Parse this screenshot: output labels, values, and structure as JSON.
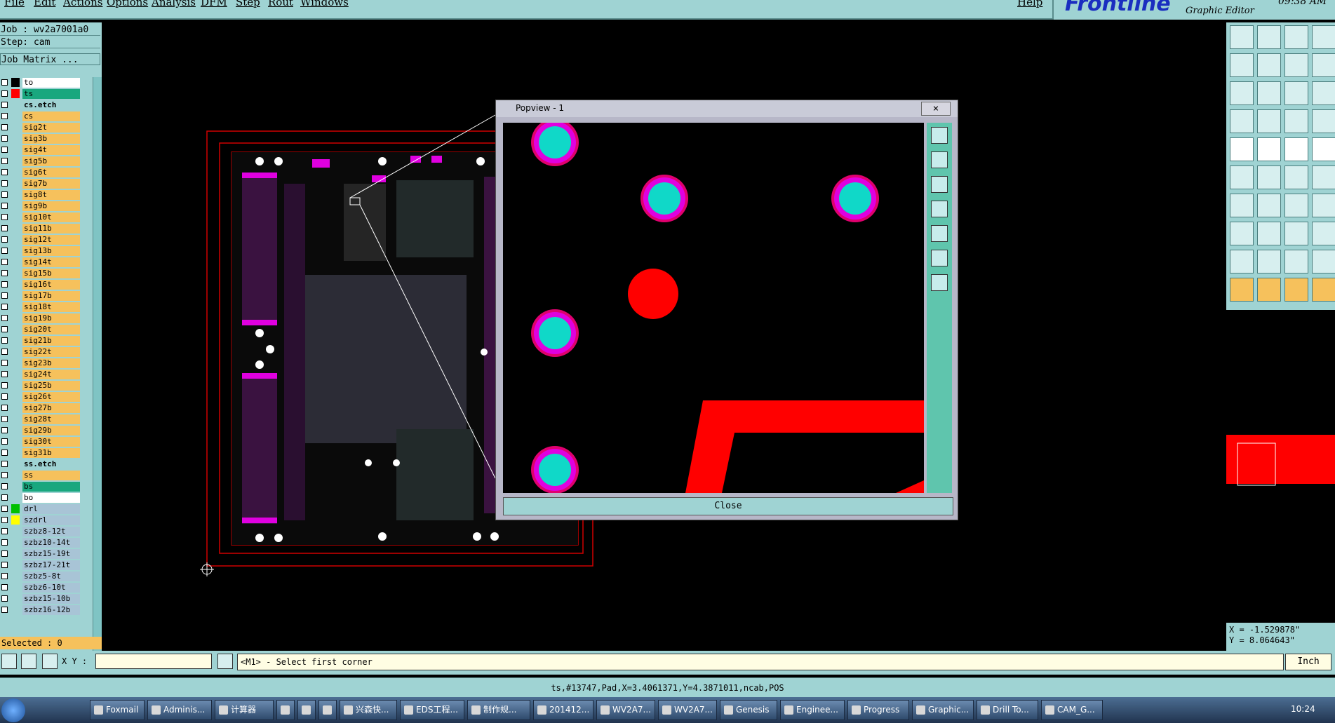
{
  "menu": {
    "items": [
      "File",
      "Edit",
      "Actions",
      "Options",
      "Analysis",
      "DFM",
      "Step",
      "Rout",
      "Windows"
    ],
    "help": "Help"
  },
  "brand": {
    "logo": "Frontline",
    "subtitle": "Graphic Editor",
    "clock": "09:38 AM"
  },
  "job": {
    "job": "Job : wv2a7001a0",
    "step": "Step: cam",
    "matrix": "Job Matrix ..."
  },
  "layers": [
    {
      "name": "to",
      "color": "#ffffff",
      "swatch": "#000000"
    },
    {
      "name": "ts",
      "color": "#19a77e",
      "swatch": "#ff0000"
    },
    {
      "name": "cs.etch",
      "color": "#9fd3d3",
      "swatch": null,
      "sep": true
    },
    {
      "name": "cs",
      "color": "#f6c15c"
    },
    {
      "name": "sig2t",
      "color": "#f6c15c"
    },
    {
      "name": "sig3b",
      "color": "#f6c15c"
    },
    {
      "name": "sig4t",
      "color": "#f6c15c"
    },
    {
      "name": "sig5b",
      "color": "#f6c15c"
    },
    {
      "name": "sig6t",
      "color": "#f6c15c"
    },
    {
      "name": "sig7b",
      "color": "#f6c15c"
    },
    {
      "name": "sig8t",
      "color": "#f6c15c"
    },
    {
      "name": "sig9b",
      "color": "#f6c15c"
    },
    {
      "name": "sig10t",
      "color": "#f6c15c"
    },
    {
      "name": "sig11b",
      "color": "#f6c15c"
    },
    {
      "name": "sig12t",
      "color": "#f6c15c"
    },
    {
      "name": "sig13b",
      "color": "#f6c15c"
    },
    {
      "name": "sig14t",
      "color": "#f6c15c"
    },
    {
      "name": "sig15b",
      "color": "#f6c15c"
    },
    {
      "name": "sig16t",
      "color": "#f6c15c"
    },
    {
      "name": "sig17b",
      "color": "#f6c15c"
    },
    {
      "name": "sig18t",
      "color": "#f6c15c"
    },
    {
      "name": "sig19b",
      "color": "#f6c15c"
    },
    {
      "name": "sig20t",
      "color": "#f6c15c"
    },
    {
      "name": "sig21b",
      "color": "#f6c15c"
    },
    {
      "name": "sig22t",
      "color": "#f6c15c"
    },
    {
      "name": "sig23b",
      "color": "#f6c15c"
    },
    {
      "name": "sig24t",
      "color": "#f6c15c"
    },
    {
      "name": "sig25b",
      "color": "#f6c15c"
    },
    {
      "name": "sig26t",
      "color": "#f6c15c"
    },
    {
      "name": "sig27b",
      "color": "#f6c15c"
    },
    {
      "name": "sig28t",
      "color": "#f6c15c"
    },
    {
      "name": "sig29b",
      "color": "#f6c15c"
    },
    {
      "name": "sig30t",
      "color": "#f6c15c"
    },
    {
      "name": "sig31b",
      "color": "#f6c15c"
    },
    {
      "name": "ss.etch",
      "color": "#9fd3d3",
      "swatch": null,
      "sep": true
    },
    {
      "name": "ss",
      "color": "#f6c15c"
    },
    {
      "name": "bs",
      "color": "#19a77e"
    },
    {
      "name": "bo",
      "color": "#ffffff"
    },
    {
      "name": "drl",
      "color": "#a8c4d6",
      "swatch": "#00c000"
    },
    {
      "name": "szdrl",
      "color": "#a8c4d6",
      "swatch": "#ffff00"
    },
    {
      "name": "szbz8-12t",
      "color": "#a8c4d6"
    },
    {
      "name": "szbz10-14t",
      "color": "#a8c4d6"
    },
    {
      "name": "szbz15-19t",
      "color": "#a8c4d6"
    },
    {
      "name": "szbz17-21t",
      "color": "#a8c4d6"
    },
    {
      "name": "szbz5-8t",
      "color": "#a8c4d6"
    },
    {
      "name": "szbz6-10t",
      "color": "#a8c4d6"
    },
    {
      "name": "szbz15-10b",
      "color": "#a8c4d6"
    },
    {
      "name": "szbz16-12b",
      "color": "#a8c4d6"
    }
  ],
  "selected": "Selected : 0",
  "popview": {
    "title": "Popview - 1",
    "close_x": "×",
    "close_label": "Close"
  },
  "coords": {
    "x": "X = -1.529878\"",
    "y": "Y = 8.064643\""
  },
  "command": {
    "xy_label": "X Y :",
    "message": "<M1> - Select first corner",
    "unit": "Inch"
  },
  "status": "ts,#13747,Pad,X=3.4061371,Y=4.3871011,ncab,POS",
  "taskbar": {
    "items": [
      "Foxmail",
      "Adminis...",
      "计算器",
      "",
      "",
      "",
      "兴森快...",
      "EDS工程...",
      "制作规...",
      "201412...",
      "WV2A7...",
      "WV2A7...",
      "Genesis",
      "Enginee...",
      "Progress",
      "Graphic...",
      "Drill To...",
      "CAM_G..."
    ],
    "time": "10:24"
  }
}
